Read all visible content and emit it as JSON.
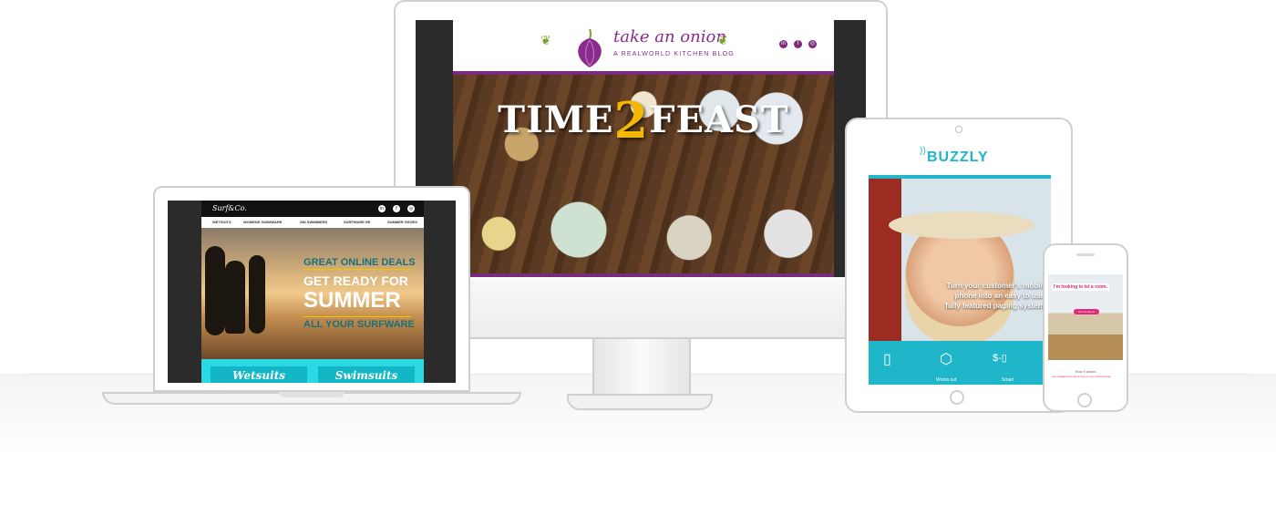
{
  "monitor_site": {
    "logo_title": "take an onion",
    "logo_subtitle": "A REALWORLD KITCHEN BLOG",
    "social": [
      "in",
      "f",
      "◎"
    ],
    "hero_left": "TIME",
    "hero_mid": "2",
    "hero_right": "FEAST"
  },
  "laptop_site": {
    "logo": "Surf&Co.",
    "social": [
      "in",
      "f",
      "◎"
    ],
    "nav": [
      "WETSUITS",
      "WOMENS SWIMWARE",
      "SNI SWIMMERS",
      "SURFWARE RE",
      "SUMMER SHOES"
    ],
    "headline_1": "GREAT ONLINE DEALS",
    "headline_2": "GET READY FOR",
    "headline_3": "SUMMER",
    "headline_4": "ALL YOUR SURFWARE",
    "buttons": [
      "Wetsuits",
      "Swimsuits"
    ]
  },
  "tablet_site": {
    "logo": "BUZZLY",
    "tagline_1": "Turn your customer's mobile",
    "tagline_2": "phone into an easy to use,",
    "tagline_3": "fully featured paging system.",
    "labels": [
      "Works out",
      "Smart"
    ]
  },
  "phone_site": {
    "question": "I'm looking to let a room.",
    "button": "List the Room",
    "how": "How it works",
    "text": "Use Instagram to list a room in your share house"
  },
  "colors": {
    "onion_purple": "#7c2a7e",
    "feast_yellow": "#f4b800",
    "surf_cyan": "#2bd9e5",
    "buzzly_cyan": "#1fb6c9",
    "room_pink": "#e0287a"
  }
}
